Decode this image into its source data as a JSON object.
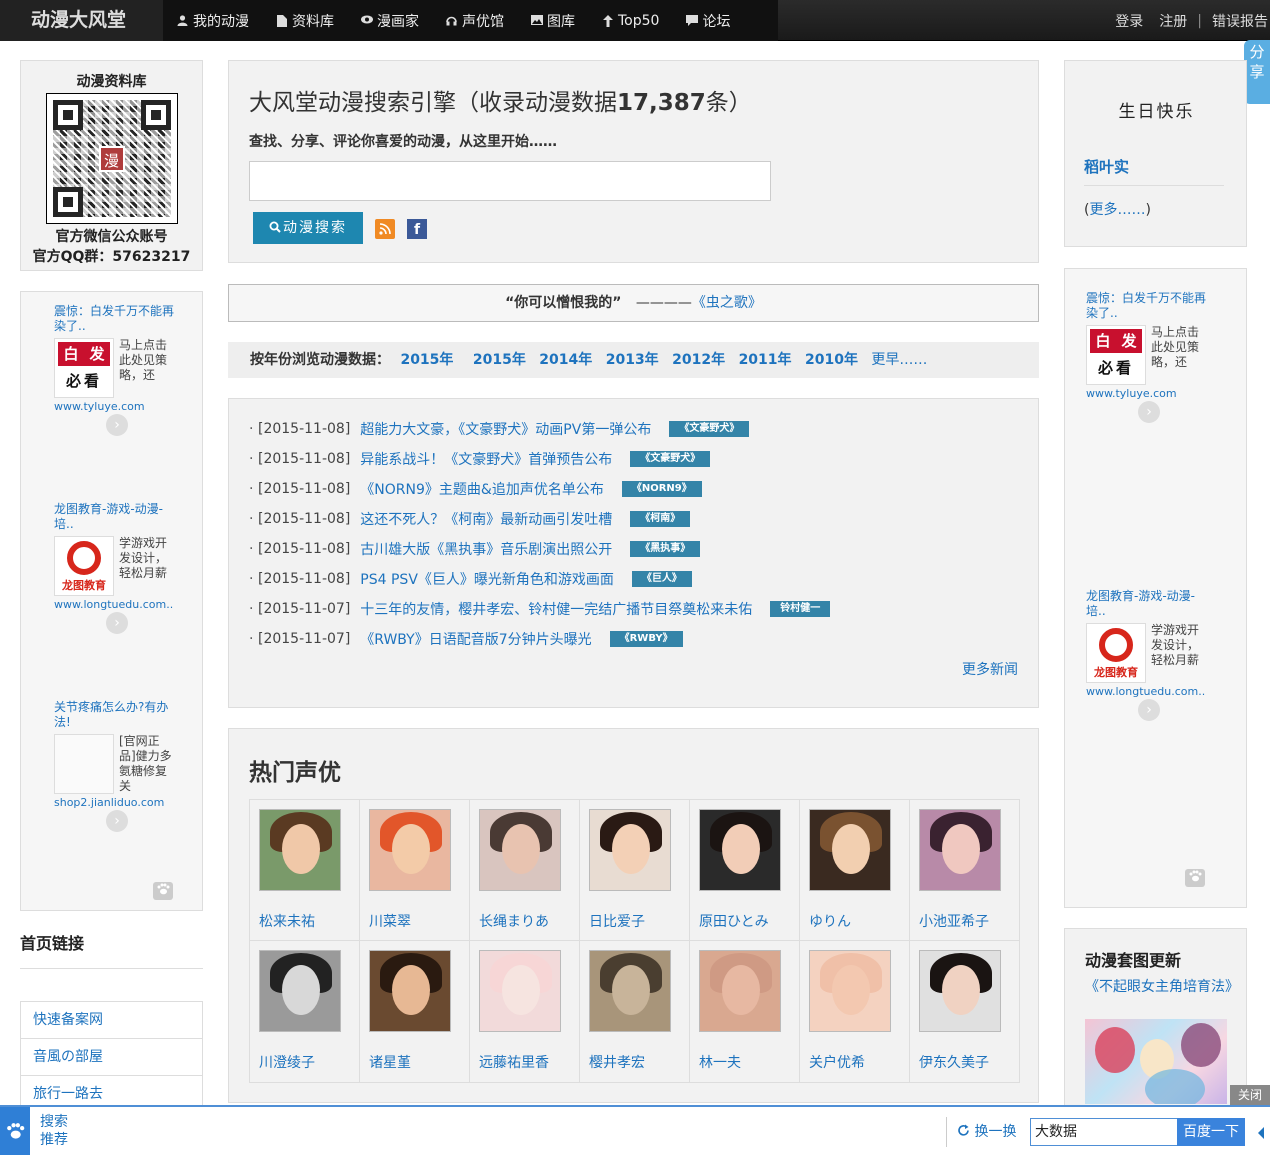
{
  "site": {
    "logo": "动漫大风堂"
  },
  "nav": {
    "items": [
      {
        "icon": "user-icon",
        "label": "我的动漫"
      },
      {
        "icon": "document-icon",
        "label": "资料库"
      },
      {
        "icon": "eye-icon",
        "label": "漫画家"
      },
      {
        "icon": "headphones-icon",
        "label": "声优馆"
      },
      {
        "icon": "image-icon",
        "label": "图库"
      },
      {
        "icon": "arrow-up-icon",
        "label": "Top50"
      },
      {
        "icon": "comment-icon",
        "label": "论坛"
      }
    ],
    "login": "登录",
    "register": "注册",
    "separator": "|",
    "report": "错误报告"
  },
  "share_tab": "分享",
  "qr": {
    "title": "动漫资料库",
    "center_char": "漫",
    "caption": "官方微信公众账号",
    "qq": "官方QQ群：57623217"
  },
  "left_ads": [
    {
      "title": "震惊：白发千万不能再染了..",
      "text": "马上点击此处见策略，还",
      "url": "www.tyluye.com",
      "img": {
        "t1": "白",
        "t2": "发",
        "t3": "必看"
      }
    },
    {
      "title": "龙图教育-游戏-动漫-培..",
      "text": "学游戏开发设计，轻松月薪",
      "url": "www.longtuedu.com...",
      "img": {
        "label": "龙图教育"
      }
    },
    {
      "title": "关节疼痛怎么办?有办法!",
      "text": "[官网正品]健力多氨糖修复关",
      "url": "shop2.jianliduo.com"
    }
  ],
  "links": {
    "title": "首页链接",
    "items": [
      "快速备案网",
      "音風の部屋",
      "旅行一路去"
    ]
  },
  "search": {
    "title_prefix": "大风堂动漫搜索引擎（收录动漫数据",
    "count": "17,387",
    "title_suffix": "条）",
    "subtitle": "查找、分享、评论你喜爱的动漫，从这里开始……",
    "input_value": "",
    "button": "动漫搜索"
  },
  "quote": {
    "text": "“你可以憎恨我的”",
    "dash": "————",
    "source": "《虫之歌》"
  },
  "years": {
    "label": "按年份浏览动漫数据：",
    "items": [
      "2015年",
      "2015年",
      "2014年",
      "2013年",
      "2012年",
      "2011年",
      "2010年"
    ],
    "more": "更早……"
  },
  "news": {
    "items": [
      {
        "date": "[2015-11-08]",
        "title": "超能力大文豪，《文豪野犬》动画PV第一弹公布",
        "tag": "《文豪野犬》"
      },
      {
        "date": "[2015-11-08]",
        "title": "异能系战斗！《文豪野犬》首弹预告公布",
        "tag": "《文豪野犬》"
      },
      {
        "date": "[2015-11-08]",
        "title": "《NORN9》主题曲&追加声优名单公布",
        "tag": "《NORN9》"
      },
      {
        "date": "[2015-11-08]",
        "title": "这还不死人？《柯南》最新动画引发吐槽",
        "tag": "《柯南》"
      },
      {
        "date": "[2015-11-08]",
        "title": "古川雄大版《黑执事》音乐剧演出照公开",
        "tag": "《黑执事》"
      },
      {
        "date": "[2015-11-08]",
        "title": "PS4 PSV《巨人》曝光新角色和游戏画面",
        "tag": "《巨人》"
      },
      {
        "date": "[2015-11-07]",
        "title": "十三年的友情，樱井孝宏、铃村健一完结广播节目祭奠松来未佑",
        "tag": "铃村健一"
      },
      {
        "date": "[2015-11-07]",
        "title": "《RWBY》日语配音版7分钟片头曝光",
        "tag": "《RWBY》"
      }
    ],
    "more": "更多新闻"
  },
  "voice_actors": {
    "title": "热门声优",
    "items": [
      {
        "name": "松来未祐",
        "hair": "#5a3a22",
        "skin": "#f0c8a8",
        "bg": "#7a9a6a"
      },
      {
        "name": "川菜翠",
        "hair": "#e2562a",
        "skin": "#f3cba8",
        "bg": "#e9b7a0"
      },
      {
        "name": "长绳まりあ",
        "hair": "#4a3a34",
        "skin": "#e8c3b0",
        "bg": "#d9c5bf"
      },
      {
        "name": "日比爱子",
        "hair": "#2a1a14",
        "skin": "#f3d0b6",
        "bg": "#e8dcd2"
      },
      {
        "name": "原田ひとみ",
        "hair": "#1b1412",
        "skin": "#f2cdb7",
        "bg": "#2a2a2a"
      },
      {
        "name": "ゆりん",
        "hair": "#7a5230",
        "skin": "#f2cfb0",
        "bg": "#3a2a20"
      },
      {
        "name": "小池亚希子",
        "hair": "#3a2230",
        "skin": "#f0c8c0",
        "bg": "#b88aa8"
      },
      {
        "name": "川澄绫子",
        "hair": "#222",
        "skin": "#d8d8d8",
        "bg": "#9a9a9a"
      },
      {
        "name": "诸星堇",
        "hair": "#2a1a10",
        "skin": "#e7b894",
        "bg": "#6a4a30"
      },
      {
        "name": "远藤祐里香",
        "hair": "#f7d6d6",
        "skin": "#f6e4e0",
        "bg": "#f2dada"
      },
      {
        "name": "樱井孝宏",
        "hair": "#4a3e30",
        "skin": "#c8b49a",
        "bg": "#a8957a"
      },
      {
        "name": "林一夫",
        "hair": "#cf9a84",
        "skin": "#e7b8a2",
        "bg": "#d9a890"
      },
      {
        "name": "关户优希",
        "hair": "#f0c0a8",
        "skin": "#f3c8b0",
        "bg": "#f4d2c0"
      },
      {
        "name": "伊东久美子",
        "hair": "#1a1412",
        "skin": "#f0d2c2",
        "bg": "#e0e0e0"
      }
    ]
  },
  "birthday": {
    "title": "生日快乐",
    "name": "稻叶实",
    "more_open": "(",
    "more": "更多……",
    "more_close": ")"
  },
  "right_ads": [
    {
      "title": "震惊：白发千万不能再染了..",
      "text": "马上点击此处见策略，还",
      "url": "www.tyluye.com",
      "img": {
        "t1": "白",
        "t2": "发",
        "t3": "必看"
      }
    },
    {
      "title": "龙图教育-游戏-动漫-培..",
      "text": "学游戏开发设计，轻松月薪",
      "url": "www.longtuedu.com...",
      "img": {
        "label": "龙图教育"
      }
    }
  ],
  "gallery": {
    "title": "动漫套图更新",
    "link": "《不起眼女主角培育法》"
  },
  "bottom": {
    "labels": [
      "搜索",
      "推荐"
    ],
    "refresh": "换一换",
    "input_value": "大数据",
    "button": "百度一下",
    "close": "关闭"
  }
}
